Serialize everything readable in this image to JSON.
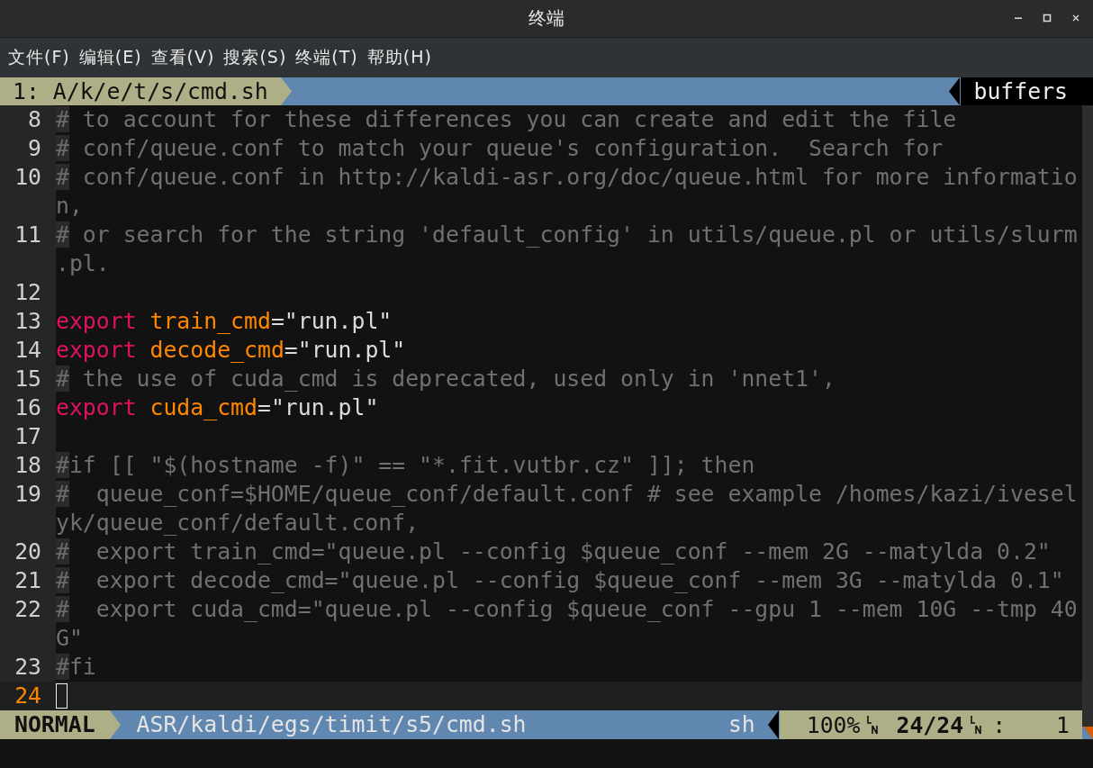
{
  "window": {
    "title": "终端"
  },
  "menu": [
    "文件(F)",
    "编辑(E)",
    "查看(V)",
    "搜索(S)",
    "终端(T)",
    "帮助(H)"
  ],
  "tabline": {
    "tabs": [
      {
        "label": "1: A/k/e/t/s/cmd.sh",
        "selected": true
      }
    ],
    "right_label": "buffers"
  },
  "editor": {
    "lines": [
      {
        "number": "8",
        "current": false,
        "rows": [
          [
            {
              "kind": "hash",
              "text": "#"
            },
            {
              "kind": "comment",
              "text": " to account for these differences you can create and edit the file"
            }
          ]
        ]
      },
      {
        "number": "9",
        "current": false,
        "rows": [
          [
            {
              "kind": "hash",
              "text": "#"
            },
            {
              "kind": "comment",
              "text": " conf/queue.conf to match your queue's configuration.  Search for"
            }
          ]
        ]
      },
      {
        "number": "10",
        "current": false,
        "rows": [
          [
            {
              "kind": "hash",
              "text": "#"
            },
            {
              "kind": "comment",
              "text": " conf/queue.conf in http://kaldi-asr.org/doc/queue.html for more informatio"
            }
          ],
          [
            {
              "kind": "wrap",
              "text": "n,"
            }
          ]
        ]
      },
      {
        "number": "11",
        "current": false,
        "rows": [
          [
            {
              "kind": "hash",
              "text": "#"
            },
            {
              "kind": "comment",
              "text": " or search for the string 'default_config' in utils/queue.pl or utils/slurm"
            }
          ],
          [
            {
              "kind": "wrap",
              "text": ".pl."
            }
          ]
        ]
      },
      {
        "number": "12",
        "current": false,
        "rows": [
          []
        ]
      },
      {
        "number": "13",
        "current": false,
        "rows": [
          [
            {
              "kind": "keyword",
              "text": "export"
            },
            {
              "kind": "plain",
              "text": " "
            },
            {
              "kind": "variable",
              "text": "train_cmd"
            },
            {
              "kind": "plain",
              "text": "=\"run.pl\""
            }
          ]
        ]
      },
      {
        "number": "14",
        "current": false,
        "rows": [
          [
            {
              "kind": "keyword",
              "text": "export"
            },
            {
              "kind": "plain",
              "text": " "
            },
            {
              "kind": "variable",
              "text": "decode_cmd"
            },
            {
              "kind": "plain",
              "text": "=\"run.pl\""
            }
          ]
        ]
      },
      {
        "number": "15",
        "current": false,
        "rows": [
          [
            {
              "kind": "hash",
              "text": "#"
            },
            {
              "kind": "comment",
              "text": " the use of cuda_cmd is deprecated, used only in 'nnet1',"
            }
          ]
        ]
      },
      {
        "number": "16",
        "current": false,
        "rows": [
          [
            {
              "kind": "keyword",
              "text": "export"
            },
            {
              "kind": "plain",
              "text": " "
            },
            {
              "kind": "variable",
              "text": "cuda_cmd"
            },
            {
              "kind": "plain",
              "text": "=\"run.pl\""
            }
          ]
        ]
      },
      {
        "number": "17",
        "current": false,
        "rows": [
          []
        ]
      },
      {
        "number": "18",
        "current": false,
        "rows": [
          [
            {
              "kind": "hash",
              "text": "#"
            },
            {
              "kind": "comment",
              "text": "if [[ \"$(hostname -f)\" == \"*.fit.vutbr.cz\" ]]; then"
            }
          ]
        ]
      },
      {
        "number": "19",
        "current": false,
        "rows": [
          [
            {
              "kind": "hash",
              "text": "#"
            },
            {
              "kind": "comment",
              "text": "  queue_conf=$HOME/queue_conf/default.conf # see example /homes/kazi/ivesel"
            }
          ],
          [
            {
              "kind": "wrap",
              "text": "yk/queue_conf/default.conf,"
            }
          ]
        ]
      },
      {
        "number": "20",
        "current": false,
        "rows": [
          [
            {
              "kind": "hash",
              "text": "#"
            },
            {
              "kind": "comment",
              "text": "  export train_cmd=\"queue.pl --config $queue_conf --mem 2G --matylda 0.2\""
            }
          ]
        ]
      },
      {
        "number": "21",
        "current": false,
        "rows": [
          [
            {
              "kind": "hash",
              "text": "#"
            },
            {
              "kind": "comment",
              "text": "  export decode_cmd=\"queue.pl --config $queue_conf --mem 3G --matylda 0.1\""
            }
          ]
        ]
      },
      {
        "number": "22",
        "current": false,
        "rows": [
          [
            {
              "kind": "hash",
              "text": "#"
            },
            {
              "kind": "comment",
              "text": "  export cuda_cmd=\"queue.pl --config $queue_conf --gpu 1 --mem 10G --tmp 40"
            }
          ],
          [
            {
              "kind": "wrap",
              "text": "G\""
            }
          ]
        ]
      },
      {
        "number": "23",
        "current": false,
        "rows": [
          [
            {
              "kind": "hash",
              "text": "#"
            },
            {
              "kind": "comment",
              "text": "fi"
            }
          ]
        ]
      },
      {
        "number": "24",
        "current": true,
        "rows": [
          []
        ]
      }
    ]
  },
  "statusline": {
    "mode": "NORMAL",
    "path": "ASR/kaldi/egs/timit/s5/cmd.sh",
    "filetype": "sh",
    "percent": "100%",
    "position": "24/24",
    "column_separator": ":",
    "column": "1"
  }
}
